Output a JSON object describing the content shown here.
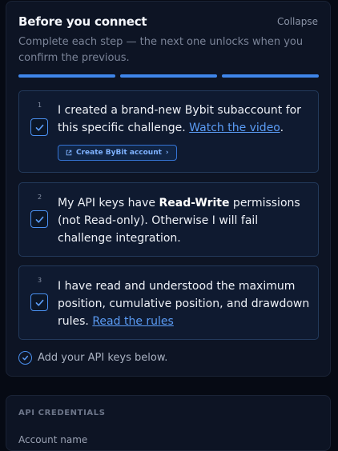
{
  "header": {
    "title": "Before you connect",
    "collapse_label": "Collapse",
    "subtitle": "Complete each step — the next one unlocks when you confirm the previous."
  },
  "progress": {
    "total_steps": 3,
    "completed_steps": 3
  },
  "steps": [
    {
      "number": "1",
      "checked": true,
      "text_before": "I created a brand-new Bybit subaccount for this specific challenge. ",
      "link": "Watch the video",
      "text_after": ".",
      "button_label": "Create ByBit account",
      "button_chevron": "›"
    },
    {
      "number": "2",
      "checked": true,
      "text_before": "My API keys have ",
      "bold": "Read-Write",
      "text_after": " permissions (not Read-only). Otherwise I will fail challenge integration."
    },
    {
      "number": "3",
      "checked": true,
      "text_before": "I have read and understood the maximum position, cumulative position, and drawdown rules. ",
      "link": "Read the rules"
    }
  ],
  "footer": {
    "text": "Add your API keys below."
  },
  "api": {
    "section_label": "API CREDENTIALS",
    "first_field_label": "Account name"
  },
  "colors": {
    "accent": "#3f86ea",
    "link": "#5b9cf5",
    "background": "#060a14",
    "card": "#0d1424"
  },
  "icons": {
    "checkbox": "check-icon",
    "external": "external-link-icon",
    "status": "check-circle-icon"
  }
}
